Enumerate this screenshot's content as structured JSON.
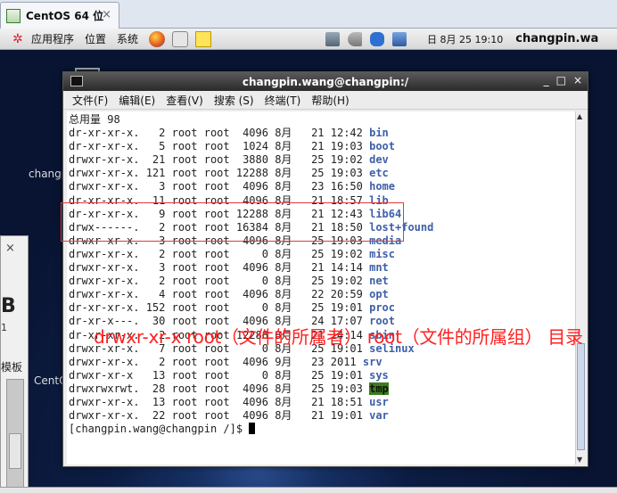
{
  "host_tab": {
    "label": "CentOS 64 位",
    "close": "×"
  },
  "panel": {
    "menus": [
      "应用程序",
      "位置",
      "系统"
    ],
    "clock": "日 8月 25 19:10",
    "user": "changpin.wa"
  },
  "desktop": {
    "label_top": "changp",
    "label_bottom": "CentO"
  },
  "bg_window": {
    "close": "×",
    "big": "B",
    "small": "1",
    "word": "模板"
  },
  "terminal": {
    "title": "changpin.wang@changpin:/",
    "controls": [
      "_",
      "□",
      "×"
    ],
    "menu": [
      "文件(F)",
      "编辑(E)",
      "查看(V)",
      "搜索 (S)",
      "终端(T)",
      "帮助(H)"
    ],
    "total": "总用量 98",
    "rows": [
      {
        "meta": "dr-xr-xr-x.   2 root root  4096 8月   21 12:42 ",
        "name": "bin"
      },
      {
        "meta": "dr-xr-xr-x.   5 root root  1024 8月   21 19:03 ",
        "name": "boot"
      },
      {
        "meta": "drwxr-xr-x.  21 root root  3880 8月   25 19:02 ",
        "name": "dev"
      },
      {
        "meta": "drwxr-xr-x. 121 root root 12288 8月   25 19:03 ",
        "name": "etc"
      },
      {
        "meta": "drwxr-xr-x.   3 root root  4096 8月   23 16:50 ",
        "name": "home"
      },
      {
        "meta": "dr-xr-xr-x.  11 root root  4096 8月   21 18:57 ",
        "name": "lib"
      },
      {
        "meta": "dr-xr-xr-x.   9 root root 12288 8月   21 12:43 ",
        "name": "lib64"
      },
      {
        "meta": "drwx------.   2 root root 16384 8月   21 18:50 ",
        "name": "lost+found"
      },
      {
        "meta": "drwxr-xr-x.   3 root root  4096 8月   25 19:03 ",
        "name": "media"
      },
      {
        "meta": "drwxr-xr-x.   2 root root     0 8月   25 19:02 ",
        "name": "misc"
      },
      {
        "meta": "drwxr-xr-x.   3 root root  4096 8月   21 14:14 ",
        "name": "mnt"
      },
      {
        "meta": "drwxr-xr-x.   2 root root     0 8月   25 19:02 ",
        "name": "net"
      },
      {
        "meta": "drwxr-xr-x.   4 root root  4096 8月   22 20:59 ",
        "name": "opt"
      },
      {
        "meta": "dr-xr-xr-x. 152 root root     0 8月   25 19:01 ",
        "name": "proc"
      },
      {
        "meta": "dr-xr-x---.  30 root root  4096 8月   24 17:07 ",
        "name": "root"
      },
      {
        "meta": "dr-xr-xr-x.   2 root root 12288 8月   21 14:14 ",
        "name": "sbin"
      },
      {
        "meta": "drwxr-xr-x.   7 root root     0 8月   25 19:01 ",
        "name": "selinux"
      },
      {
        "meta": "drwxr-xr-x.   2 root root  4096 9月   23 2011 ",
        "name": "srv"
      },
      {
        "meta": "drwxr-xr-x   13 root root     0 8月   25 19:01 ",
        "name": "sys"
      },
      {
        "meta": "drwxrwxrwt.  28 root root  4096 8月   25 19:03 ",
        "name": "tmp"
      },
      {
        "meta": "drwxr-xr-x.  13 root root  4096 8月   21 18:51 ",
        "name": "usr"
      },
      {
        "meta": "drwxr-xr-x.  22 root root  4096 8月   21 19:01 ",
        "name": "var"
      }
    ],
    "prompt": "[changpin.wang@changpin /]$ "
  },
  "annotation": "drwxr-xr-x root（文件的所属者） root（文件的所属组） 目录"
}
